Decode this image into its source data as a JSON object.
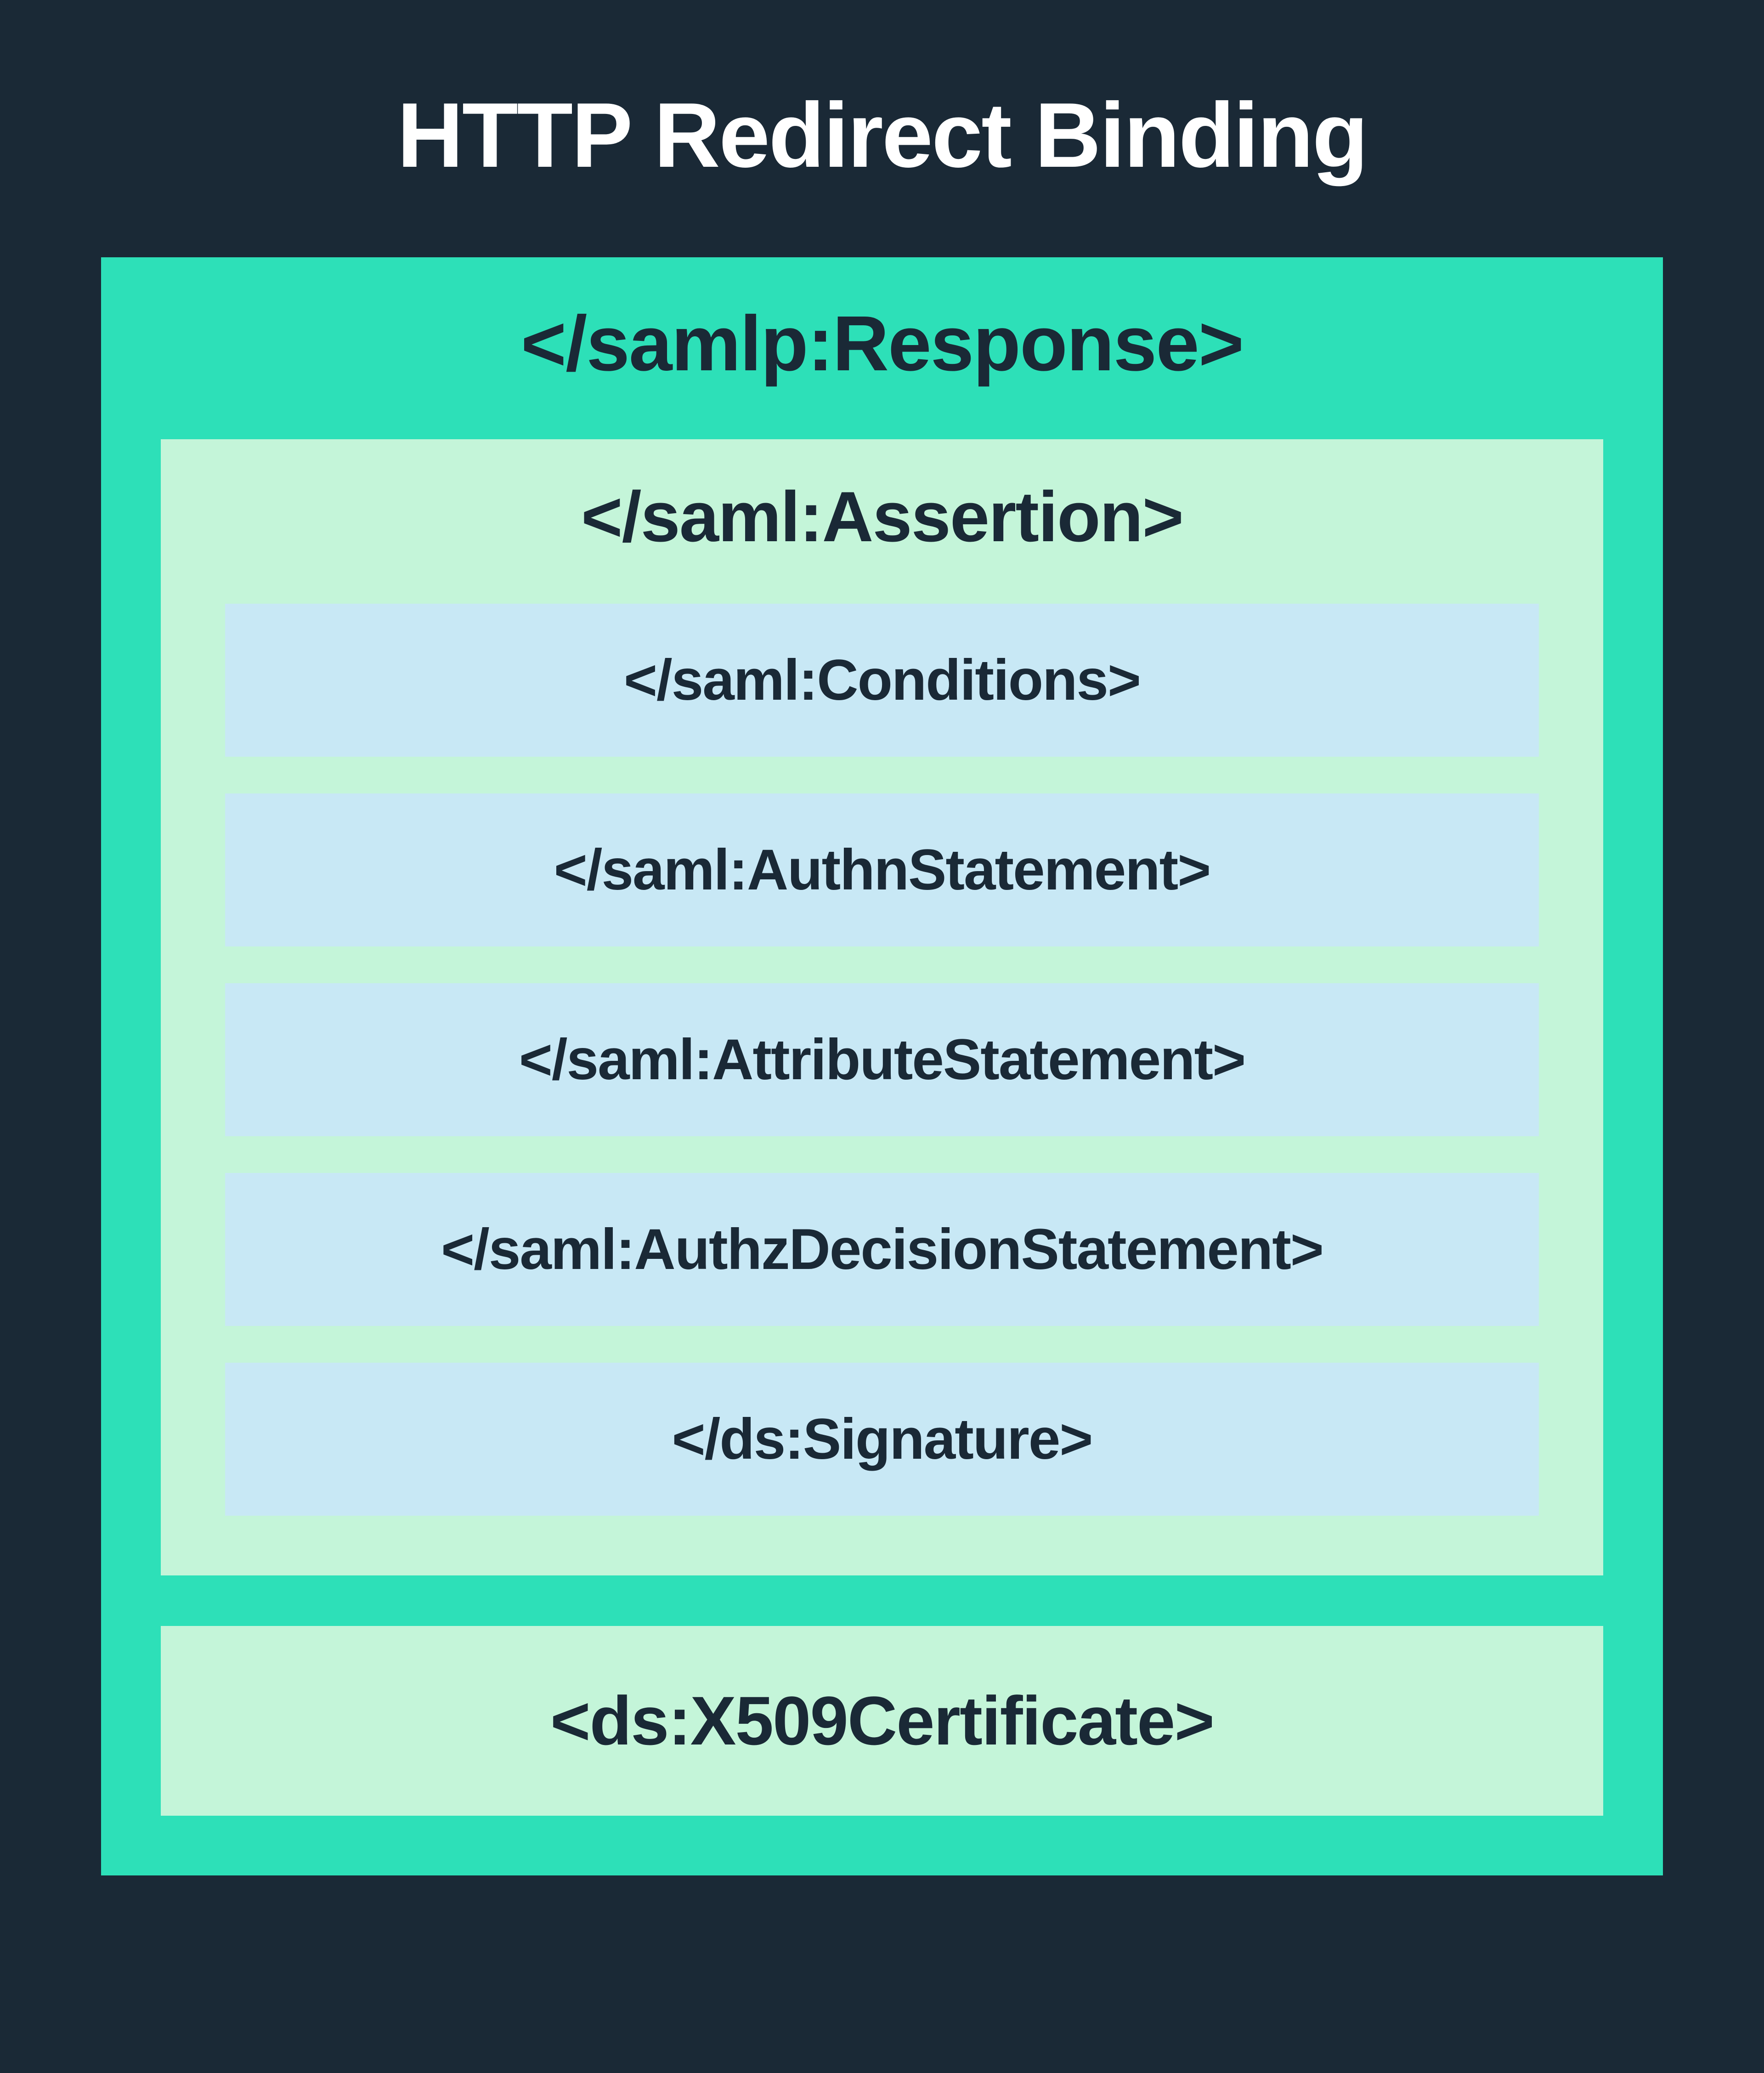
{
  "title": "HTTP Redirect Binding",
  "response": {
    "label": "</samlp:Response>",
    "assertion": {
      "label": "</saml:Assertion>",
      "elements": [
        "</saml:Conditions>",
        "</saml:AuthnStatement>",
        "</saml:AttributeStatement>",
        "</saml:AuthzDecisionStatement>",
        "</ds:Signature>"
      ]
    },
    "certificate": "<ds:X509Certificate>"
  }
}
